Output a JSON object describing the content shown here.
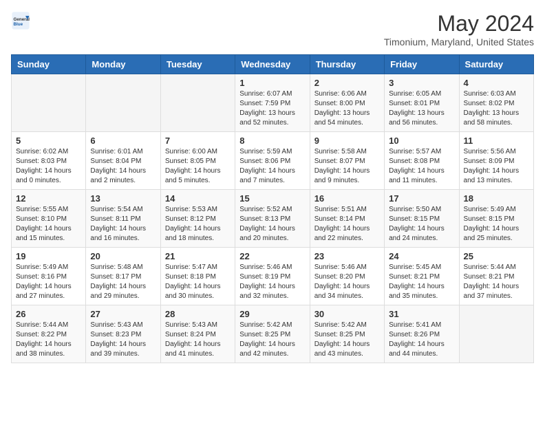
{
  "header": {
    "logo_general": "General",
    "logo_blue": "Blue",
    "month_year": "May 2024",
    "location": "Timonium, Maryland, United States"
  },
  "days_of_week": [
    "Sunday",
    "Monday",
    "Tuesday",
    "Wednesday",
    "Thursday",
    "Friday",
    "Saturday"
  ],
  "weeks": [
    [
      {
        "day": "",
        "info": ""
      },
      {
        "day": "",
        "info": ""
      },
      {
        "day": "",
        "info": ""
      },
      {
        "day": "1",
        "info": "Sunrise: 6:07 AM\nSunset: 7:59 PM\nDaylight: 13 hours\nand 52 minutes."
      },
      {
        "day": "2",
        "info": "Sunrise: 6:06 AM\nSunset: 8:00 PM\nDaylight: 13 hours\nand 54 minutes."
      },
      {
        "day": "3",
        "info": "Sunrise: 6:05 AM\nSunset: 8:01 PM\nDaylight: 13 hours\nand 56 minutes."
      },
      {
        "day": "4",
        "info": "Sunrise: 6:03 AM\nSunset: 8:02 PM\nDaylight: 13 hours\nand 58 minutes."
      }
    ],
    [
      {
        "day": "5",
        "info": "Sunrise: 6:02 AM\nSunset: 8:03 PM\nDaylight: 14 hours\nand 0 minutes."
      },
      {
        "day": "6",
        "info": "Sunrise: 6:01 AM\nSunset: 8:04 PM\nDaylight: 14 hours\nand 2 minutes."
      },
      {
        "day": "7",
        "info": "Sunrise: 6:00 AM\nSunset: 8:05 PM\nDaylight: 14 hours\nand 5 minutes."
      },
      {
        "day": "8",
        "info": "Sunrise: 5:59 AM\nSunset: 8:06 PM\nDaylight: 14 hours\nand 7 minutes."
      },
      {
        "day": "9",
        "info": "Sunrise: 5:58 AM\nSunset: 8:07 PM\nDaylight: 14 hours\nand 9 minutes."
      },
      {
        "day": "10",
        "info": "Sunrise: 5:57 AM\nSunset: 8:08 PM\nDaylight: 14 hours\nand 11 minutes."
      },
      {
        "day": "11",
        "info": "Sunrise: 5:56 AM\nSunset: 8:09 PM\nDaylight: 14 hours\nand 13 minutes."
      }
    ],
    [
      {
        "day": "12",
        "info": "Sunrise: 5:55 AM\nSunset: 8:10 PM\nDaylight: 14 hours\nand 15 minutes."
      },
      {
        "day": "13",
        "info": "Sunrise: 5:54 AM\nSunset: 8:11 PM\nDaylight: 14 hours\nand 16 minutes."
      },
      {
        "day": "14",
        "info": "Sunrise: 5:53 AM\nSunset: 8:12 PM\nDaylight: 14 hours\nand 18 minutes."
      },
      {
        "day": "15",
        "info": "Sunrise: 5:52 AM\nSunset: 8:13 PM\nDaylight: 14 hours\nand 20 minutes."
      },
      {
        "day": "16",
        "info": "Sunrise: 5:51 AM\nSunset: 8:14 PM\nDaylight: 14 hours\nand 22 minutes."
      },
      {
        "day": "17",
        "info": "Sunrise: 5:50 AM\nSunset: 8:15 PM\nDaylight: 14 hours\nand 24 minutes."
      },
      {
        "day": "18",
        "info": "Sunrise: 5:49 AM\nSunset: 8:15 PM\nDaylight: 14 hours\nand 25 minutes."
      }
    ],
    [
      {
        "day": "19",
        "info": "Sunrise: 5:49 AM\nSunset: 8:16 PM\nDaylight: 14 hours\nand 27 minutes."
      },
      {
        "day": "20",
        "info": "Sunrise: 5:48 AM\nSunset: 8:17 PM\nDaylight: 14 hours\nand 29 minutes."
      },
      {
        "day": "21",
        "info": "Sunrise: 5:47 AM\nSunset: 8:18 PM\nDaylight: 14 hours\nand 30 minutes."
      },
      {
        "day": "22",
        "info": "Sunrise: 5:46 AM\nSunset: 8:19 PM\nDaylight: 14 hours\nand 32 minutes."
      },
      {
        "day": "23",
        "info": "Sunrise: 5:46 AM\nSunset: 8:20 PM\nDaylight: 14 hours\nand 34 minutes."
      },
      {
        "day": "24",
        "info": "Sunrise: 5:45 AM\nSunset: 8:21 PM\nDaylight: 14 hours\nand 35 minutes."
      },
      {
        "day": "25",
        "info": "Sunrise: 5:44 AM\nSunset: 8:21 PM\nDaylight: 14 hours\nand 37 minutes."
      }
    ],
    [
      {
        "day": "26",
        "info": "Sunrise: 5:44 AM\nSunset: 8:22 PM\nDaylight: 14 hours\nand 38 minutes."
      },
      {
        "day": "27",
        "info": "Sunrise: 5:43 AM\nSunset: 8:23 PM\nDaylight: 14 hours\nand 39 minutes."
      },
      {
        "day": "28",
        "info": "Sunrise: 5:43 AM\nSunset: 8:24 PM\nDaylight: 14 hours\nand 41 minutes."
      },
      {
        "day": "29",
        "info": "Sunrise: 5:42 AM\nSunset: 8:25 PM\nDaylight: 14 hours\nand 42 minutes."
      },
      {
        "day": "30",
        "info": "Sunrise: 5:42 AM\nSunset: 8:25 PM\nDaylight: 14 hours\nand 43 minutes."
      },
      {
        "day": "31",
        "info": "Sunrise: 5:41 AM\nSunset: 8:26 PM\nDaylight: 14 hours\nand 44 minutes."
      },
      {
        "day": "",
        "info": ""
      }
    ]
  ]
}
